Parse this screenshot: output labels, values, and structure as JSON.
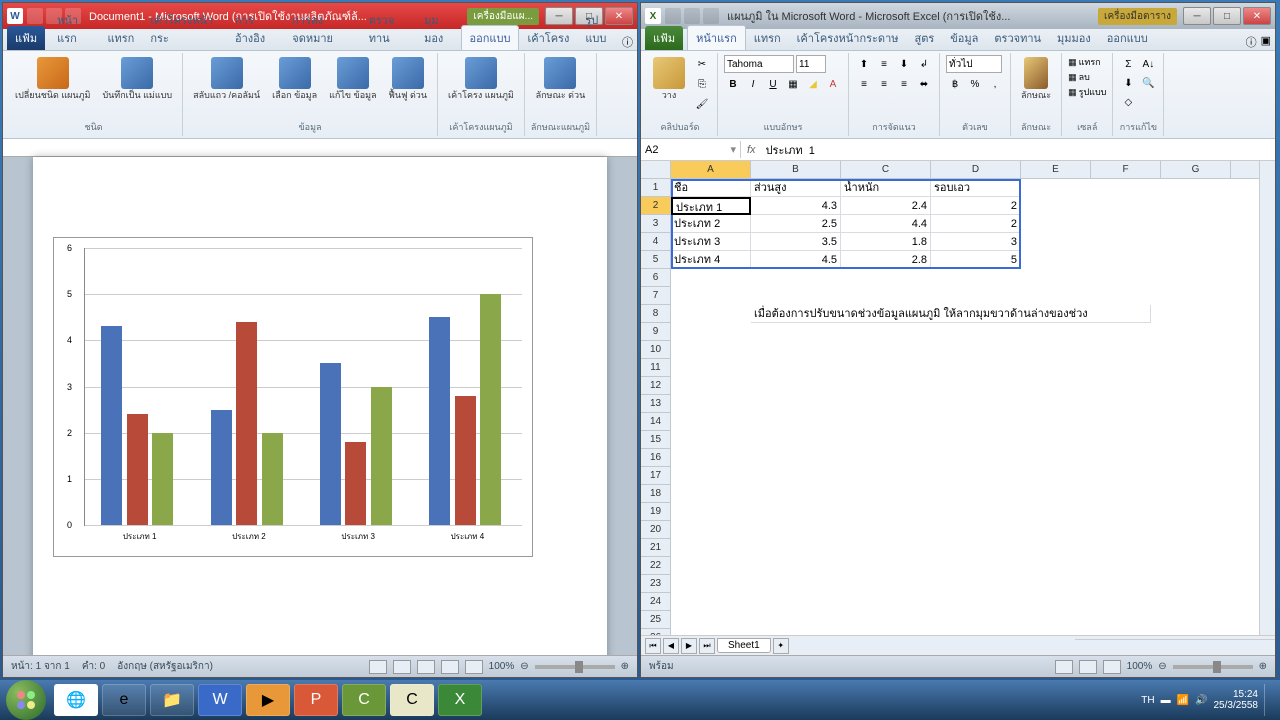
{
  "word": {
    "title": "Document1 - Microsoft Word (การเปิดใช้งานผลิตภัณฑ์ล้...",
    "title_extra": "เครื่องมือแผ...",
    "tabs": {
      "file": "แฟ้ม",
      "home": "หน้าแรก",
      "insert": "แทรก",
      "layout": "เค้าโครงหน้ากระ",
      "ref": "การอ้างอิง",
      "mail": "การส่งจดหมาย",
      "review": "ตรวจทาน",
      "view": "มุมมอง",
      "design": "ออกแบบ",
      "layout2": "เค้าโครง",
      "format": "รูปแบบ"
    },
    "ribbon": {
      "g1": {
        "b1": "เปลี่ยนชนิด\nแผนภูมิ",
        "b2": "บันทึกเป็น\nแม่แบบ",
        "label": "ชนิด"
      },
      "g2": {
        "b1": "สลับแถว\n/คอลัมน์",
        "b2": "เลือก\nข้อมูล",
        "b3": "แก้ไข\nข้อมูล",
        "b4": "ฟื้นฟู\nด่วน",
        "label": "ข้อมูล"
      },
      "g3": {
        "b1": "เค้าโครง\nแผนภูมิ",
        "label": "เค้าโครงแผนภูมิ"
      },
      "g4": {
        "b1": "ลักษณะ\nด่วน",
        "label": "ลักษณะแผนภูมิ"
      }
    },
    "status": {
      "page": "หน้า: 1 จาก 1",
      "words": "คำ: 0",
      "lang": "อังกฤษ (สหรัฐอเมริกา)",
      "zoom": "100%"
    }
  },
  "excel": {
    "title": "แผนภูมิ ใน Microsoft Word - Microsoft Excel (การเปิดใช้ง...",
    "title_extra": "เครื่องมือตาราง",
    "tabs": {
      "file": "แฟ้ม",
      "home": "หน้าแรก",
      "insert": "แทรก",
      "layout": "เค้าโครงหน้ากระดาษ",
      "formulas": "สูตร",
      "data": "ข้อมูล",
      "review": "ตรวจทาน",
      "view": "มุมมอง",
      "design": "ออกแบบ"
    },
    "ribbon": {
      "clip": "คลิปบอร์ด",
      "paste": "วาง",
      "font": "แบบอักษร",
      "fontname": "Tahoma",
      "fontsize": "11",
      "align": "การจัดแนว",
      "num": "ตัวเลข",
      "numfmt": "ทั่วไป",
      "styles": "ลักษณะ",
      "cells": "เซลล์",
      "edit": "การแก้ไข",
      "insert": "แทรก",
      "delete": "ลบ",
      "format": "รูปแบบ"
    },
    "namebox": "A2",
    "formula": "ประเภท  1",
    "cols": [
      "A",
      "B",
      "C",
      "D",
      "E",
      "F",
      "G"
    ],
    "headers": {
      "A": "ชื่อ",
      "B": "ส่วนสูง",
      "C": "น้ำหนัก",
      "D": "รอบเอว"
    },
    "rows": [
      {
        "A": "ประเภท 1",
        "B": "4.3",
        "C": "2.4",
        "D": "2"
      },
      {
        "A": "ประเภท 2",
        "B": "2.5",
        "C": "4.4",
        "D": "2"
      },
      {
        "A": "ประเภท 3",
        "B": "3.5",
        "C": "1.8",
        "D": "3"
      },
      {
        "A": "ประเภท 4",
        "B": "4.5",
        "C": "2.8",
        "D": "5"
      }
    ],
    "hint": "เมื่อต้องการปรับขนาดช่วงข้อมูลแผนภูมิ ให้ลากมุมขวาด้านล่างของช่วง",
    "sheet": "Sheet1",
    "status": {
      "ready": "พร้อม",
      "zoom": "100%"
    }
  },
  "chart_data": {
    "type": "bar",
    "categories": [
      "ประเภท 1",
      "ประเภท 2",
      "ประเภท 3",
      "ประเภท 4"
    ],
    "series": [
      {
        "name": "ส่วนสูง",
        "values": [
          4.3,
          2.5,
          3.5,
          4.5
        ],
        "color": "#4a72b8"
      },
      {
        "name": "น้ำหนัก",
        "values": [
          2.4,
          4.4,
          1.8,
          2.8
        ],
        "color": "#b84a3a"
      },
      {
        "name": "รอบเอว",
        "values": [
          2,
          2,
          3,
          5
        ],
        "color": "#8aa84a"
      }
    ],
    "ylim": [
      0,
      6
    ]
  },
  "taskbar": {
    "time": "15:24",
    "date": "25/3/2558",
    "lang": "TH"
  }
}
